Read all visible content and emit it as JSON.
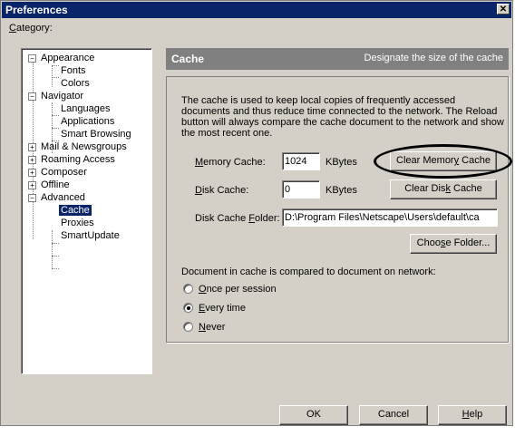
{
  "window": {
    "title": "Preferences",
    "close_glyph": "✕"
  },
  "category": {
    "label_prefix": "",
    "label_accel": "C",
    "label_rest": "ategory:"
  },
  "tree": {
    "items": [
      {
        "label": "Appearance",
        "expander": "−"
      },
      {
        "label": "Fonts"
      },
      {
        "label": "Colors"
      },
      {
        "label": "Navigator",
        "expander": "−"
      },
      {
        "label": "Languages"
      },
      {
        "label": "Applications"
      },
      {
        "label": "Smart Browsing"
      },
      {
        "label": "Mail & Newsgroups",
        "expander": "+"
      },
      {
        "label": "Roaming Access",
        "expander": "+"
      },
      {
        "label": "Composer",
        "expander": "+"
      },
      {
        "label": "Offline",
        "expander": "+"
      },
      {
        "label": "Advanced",
        "expander": "−"
      },
      {
        "label": "Cache",
        "selected": true
      },
      {
        "label": "Proxies"
      },
      {
        "label": "SmartUpdate"
      }
    ]
  },
  "panel": {
    "title": "Cache",
    "description": "Designate the size of the cache",
    "intro_text": "The cache is used to keep local copies of frequently accessed documents and thus reduce time connected to the network. The Reload button will always compare the cache document to the network and show the most recent one."
  },
  "memory_cache": {
    "label_accel": "M",
    "label_rest": "emory Cache:",
    "value": "1024",
    "unit": "KBytes",
    "button_pre": "Clear Memor",
    "button_accel": "y",
    "button_post": " Cache"
  },
  "disk_cache": {
    "label_accel": "D",
    "label_rest": "isk Cache:",
    "value": "0",
    "unit": "KBytes",
    "button_pre": "Clear Dis",
    "button_accel": "k",
    "button_post": " Cache"
  },
  "disk_cache_folder": {
    "label_pre": "Disk Cache ",
    "label_accel": "F",
    "label_post": "older:",
    "value": "D:\\Program Files\\Netscape\\Users\\default\\ca",
    "button_pre": "Choo",
    "button_accel": "s",
    "button_post": "e Folder..."
  },
  "compare": {
    "label": "Document in cache is compared to document on network:",
    "options": [
      {
        "accel": "O",
        "rest": "nce per session",
        "checked": false
      },
      {
        "accel": "E",
        "rest": "very time",
        "checked": true
      },
      {
        "accel": "N",
        "rest": "ever",
        "checked": false
      }
    ]
  },
  "footer": {
    "ok": "OK",
    "cancel": "Cancel",
    "help_accel": "H",
    "help_rest": "elp"
  }
}
